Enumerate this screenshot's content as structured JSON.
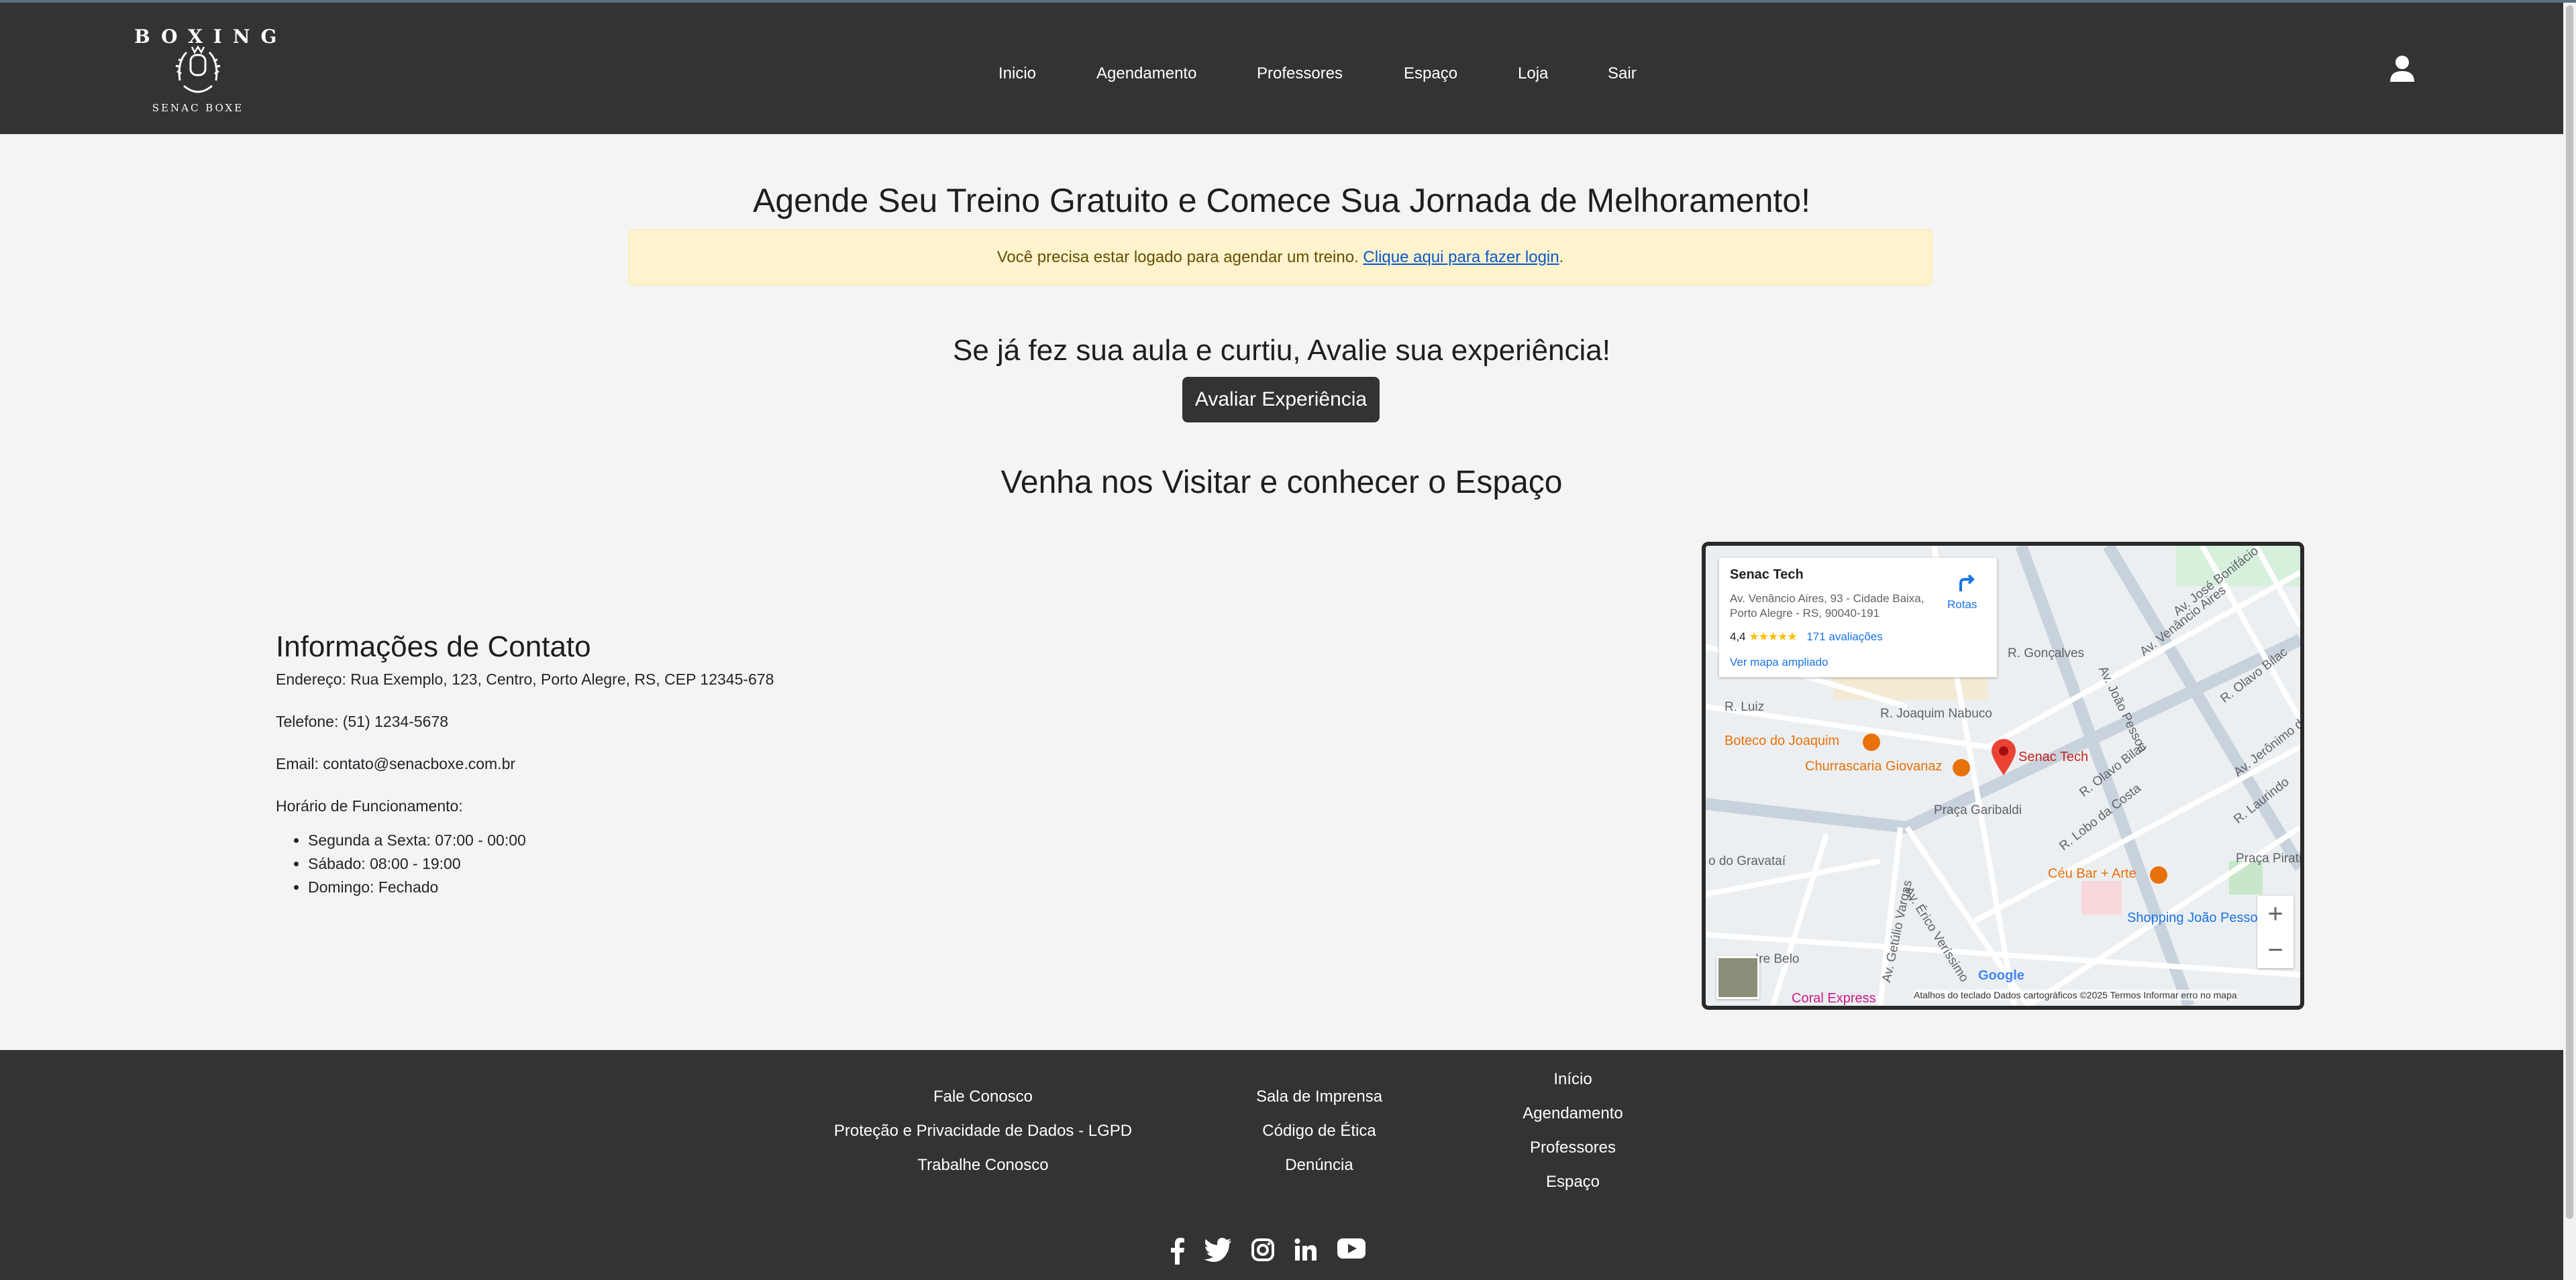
{
  "brand": {
    "logo_top": "BOXING",
    "logo_bottom": "SENAC BOXE"
  },
  "nav": {
    "items": [
      {
        "label": "Inicio"
      },
      {
        "label": "Agendamento"
      },
      {
        "label": "Professores"
      },
      {
        "label": "Espaço"
      },
      {
        "label": "Loja"
      },
      {
        "label": "Sair"
      }
    ]
  },
  "icons": {
    "user": "user-icon",
    "facebook": "facebook-icon",
    "twitter": "twitter-icon",
    "instagram": "instagram-icon",
    "linkedin": "linkedin-icon",
    "youtube": "youtube-icon"
  },
  "main": {
    "heading": "Agende Seu Treino Gratuito e Comece Sua Jornada de Melhoramento!",
    "alert_text": "Você precisa estar logado para agendar um treino.",
    "alert_link": "Clique aqui para fazer login",
    "alert_period": ".",
    "review_heading": "Se já fez sua aula e curtiu, Avalie sua experiência!",
    "review_button": "Avaliar Experiência",
    "visit_heading": "Venha nos Visitar e conhecer o Espaço"
  },
  "contact": {
    "title": "Informações de Contato",
    "address": "Endereço: Rua Exemplo, 123, Centro, Porto Alegre, RS, CEP 12345-678",
    "phone": "Telefone: (51) 1234-5678",
    "email": "Email: contato@senacboxe.com.br",
    "hours_title": "Horário de Funcionamento:",
    "hours": [
      "Segunda a Sexta: 07:00 - 00:00",
      "Sábado: 08:00 - 19:00",
      "Domingo: Fechado"
    ]
  },
  "map": {
    "place_name": "Senac Tech",
    "place_address": "Av. Venâncio Aires, 93 - Cidade Baixa, Porto Alegre - RS, 90040-191",
    "rating": "4,4",
    "stars": "★★★★★",
    "reviews": "171 avaliações",
    "directions": "Rotas",
    "larger_map": "Ver mapa ampliado",
    "pois": {
      "boteco": "Boteco do Joaquim",
      "churrascaria": "Churrascaria Giovanaz",
      "senac": "Senac Tech",
      "ceu_bar": "Céu Bar + Arte",
      "shopping": "Shopping João Pessoa",
      "coral": "Coral Express",
      "praca_garibaldi": "Praça Garibaldi",
      "praca_piratini": "Praça Piratin",
      "av_joao_pessoa": "Av. João Pessoa",
      "av_venancio": "Av. Venâncio Aires",
      "av_jose_bonifacio": "Av. José Bonifácio",
      "r_joaquim_nabuco": "R. Joaquim Nabuco",
      "r_goncalves": "R. Gonçalves",
      "av_erico": "Av. Érico Veríssimo",
      "av_getulio": "Av. Getúlio Vargas",
      "r_lobo_da_costa": "R. Lobo da Costa",
      "r_olavo_bilac": "R. Olavo Bilac",
      "r_luiz": "R. Luiz",
      "gravatai": "o do Gravataí",
      "ire_belo": "Ire Belo",
      "av_jeronimo": "Av. Jerônimo de",
      "r_laurindo": "R. Laurindo",
      "r_olavo_bilac2": "R. Olavo Bilac"
    },
    "google": "Google",
    "attribution": "Atalhos do teclado   Dados cartográficos ©2025   Termos   Informar erro no mapa",
    "zoom_in": "+",
    "zoom_out": "−"
  },
  "footer": {
    "col1": [
      "Fale Conosco",
      "Proteção e Privacidade de Dados - LGPD",
      "Trabalhe Conosco"
    ],
    "col2": [
      "Sala de Imprensa",
      "Código de Ética",
      "Denúncia"
    ],
    "col3": [
      "Início",
      "Agendamento",
      "Professores",
      "Espaço"
    ]
  }
}
